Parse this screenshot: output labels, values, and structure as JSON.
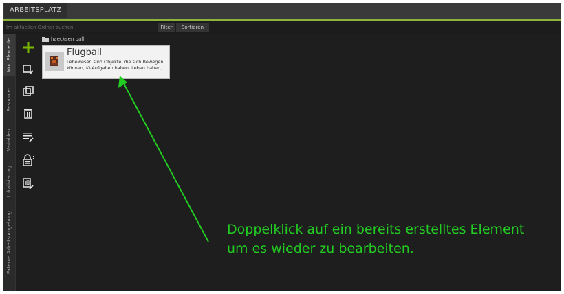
{
  "header": {
    "tab_label": "ARBEITSPLATZ"
  },
  "search": {
    "placeholder": "Im aktuellen Ordner suchen",
    "filter_label": "Filter",
    "sort_label": "Sortieren"
  },
  "sidebar": {
    "tabs": [
      {
        "label": "Mod Elemente"
      },
      {
        "label": "Resourcen"
      },
      {
        "label": "Variablen"
      },
      {
        "label": "Lokalisierung"
      },
      {
        "label": "Externe Arbeitsumgebung"
      }
    ]
  },
  "toolbar": {
    "icons": [
      "add-icon",
      "edit-element-icon",
      "duplicate-icon",
      "delete-icon",
      "properties-icon",
      "lock-icon",
      "id-edit-icon"
    ],
    "accent": "#7ab800"
  },
  "content": {
    "folder_label": "haecksen ball",
    "card": {
      "title": "Flugball",
      "description": "Lebewesen sind Objekte, die sich Bewegen können, KI-Aufgaben haben, Leben haben, ..."
    }
  },
  "annotation": {
    "line1": "Doppelklick auf ein bereits erstelltes Element",
    "line2": "um es wieder zu bearbeiten.",
    "color": "#22cc22"
  }
}
